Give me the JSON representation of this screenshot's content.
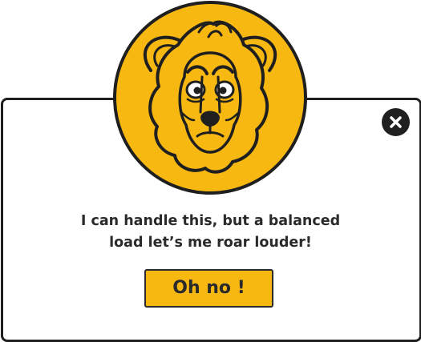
{
  "dialog": {
    "message_line1": "I can handle this, but a balanced",
    "message_line2": "load let’s me roar louder!",
    "confirm_label": "Oh no !",
    "close_icon": "close-icon",
    "mascot_icon": "lion-icon"
  },
  "colors": {
    "accent": "#f8b812",
    "outline": "#1f1f1f",
    "background": "#ffffff"
  }
}
